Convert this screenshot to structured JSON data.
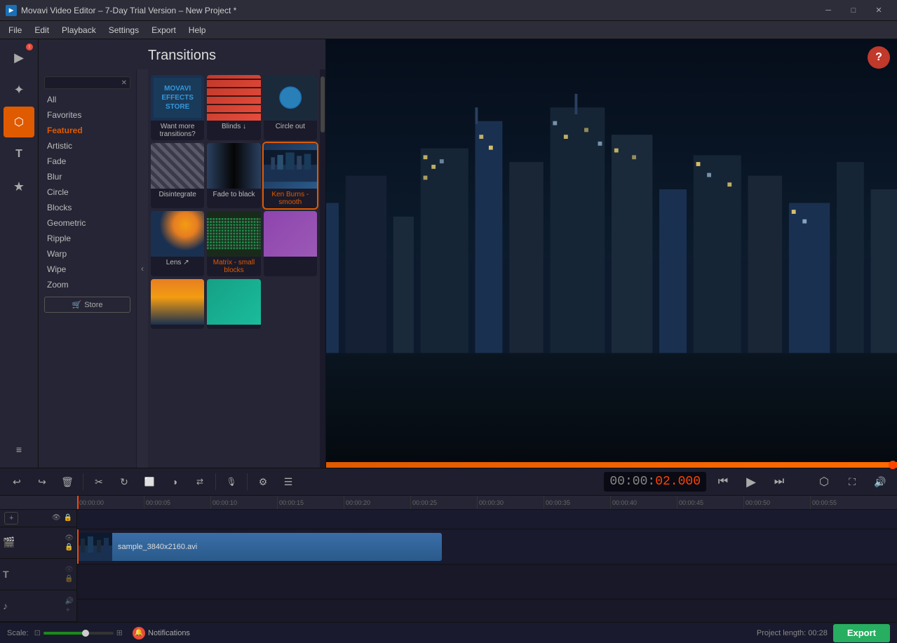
{
  "titleBar": {
    "appName": "Movavi Video Editor",
    "version": "7-Day Trial Version",
    "project": "New Project *",
    "minLabel": "─",
    "maxLabel": "□",
    "closeLabel": "✕"
  },
  "menuBar": {
    "items": [
      "File",
      "Edit",
      "Playback",
      "Settings",
      "Export",
      "Help"
    ]
  },
  "transitions": {
    "title": "Transitions",
    "searchPlaceholder": "",
    "categories": [
      {
        "id": "all",
        "label": "All",
        "active": false
      },
      {
        "id": "favorites",
        "label": "Favorites",
        "active": false
      },
      {
        "id": "featured",
        "label": "Featured",
        "active": true
      },
      {
        "id": "artistic",
        "label": "Artistic",
        "active": false
      },
      {
        "id": "fade",
        "label": "Fade",
        "active": false
      },
      {
        "id": "blur",
        "label": "Blur",
        "active": false
      },
      {
        "id": "circle",
        "label": "Circle",
        "active": false
      },
      {
        "id": "blocks",
        "label": "Blocks",
        "active": false
      },
      {
        "id": "geometric",
        "label": "Geometric",
        "active": false
      },
      {
        "id": "ripple",
        "label": "Ripple",
        "active": false
      },
      {
        "id": "warp",
        "label": "Warp",
        "active": false
      },
      {
        "id": "wipe",
        "label": "Wipe",
        "active": false
      },
      {
        "id": "zoom",
        "label": "Zoom",
        "active": false
      }
    ],
    "storeBtn": "Store",
    "items": [
      {
        "id": "effects-store",
        "label": "Want more transitions?",
        "type": "store",
        "highlighted": false
      },
      {
        "id": "blinds",
        "label": "Blinds ↓",
        "type": "blinds",
        "highlighted": false
      },
      {
        "id": "circle-out",
        "label": "Circle out",
        "type": "circle-out",
        "highlighted": false
      },
      {
        "id": "disintegrate",
        "label": "Disintegrate",
        "type": "disintegrate",
        "highlighted": false
      },
      {
        "id": "fade-black",
        "label": "Fade to black",
        "type": "fade-black",
        "highlighted": false
      },
      {
        "id": "ken-burns",
        "label": "Ken Burns - smooth",
        "type": "ken-burns",
        "highlighted": true
      },
      {
        "id": "lens",
        "label": "Lens ↗",
        "type": "lens",
        "highlighted": false
      },
      {
        "id": "matrix",
        "label": "Matrix - small blocks",
        "type": "matrix",
        "highlighted": true
      },
      {
        "id": "row2-1",
        "label": "",
        "type": "row2-1",
        "highlighted": false
      },
      {
        "id": "row2-2",
        "label": "",
        "type": "row2-2",
        "highlighted": false
      },
      {
        "id": "row2-3",
        "label": "",
        "type": "row2-3",
        "highlighted": false
      }
    ]
  },
  "preview": {
    "helpLabel": "?",
    "progressValue": 100
  },
  "editToolbar": {
    "undo": "↩",
    "redo": "↪",
    "delete": "🗑",
    "cut": "✂",
    "rotate": "↻",
    "crop": "⬜",
    "color": "◑",
    "flip": "⇄",
    "audio": "🎙",
    "settings": "⚙",
    "effects": "☰",
    "timeNormal": "00:00:",
    "timeHighlight": "02.000",
    "prevFrame": "⏮",
    "play": "▶",
    "nextFrame": "⏭",
    "export2": "⬡",
    "fullscreen": "⛶",
    "volume": "🔊"
  },
  "timeline": {
    "playheadPos": 0,
    "rulerMarks": [
      "00:00:00",
      "00:00:05",
      "00:00:10",
      "00:00:15",
      "00:00:20",
      "00:00:25",
      "00:00:30",
      "00:00:35",
      "00:00:40",
      "00:00:45",
      "00:00:50",
      "00:00:55"
    ],
    "tracks": [
      {
        "type": "video",
        "icon": "🎬",
        "hasEye": true,
        "hasLock": true
      },
      {
        "type": "text",
        "icon": "T",
        "hasEye": false,
        "hasLock": false
      },
      {
        "type": "music",
        "icon": "♪",
        "hasEye": false,
        "hasLock": false
      }
    ],
    "clips": [
      {
        "name": "sample_3840x2160.avi",
        "startPct": 0,
        "widthPct": 48,
        "track": 0
      }
    ]
  },
  "bottomBar": {
    "scaleLabel": "Scale:",
    "notificationsLabel": "Notifications",
    "projectLengthLabel": "Project length:",
    "projectLength": "00:28",
    "exportLabel": "Export"
  },
  "icons": {
    "search": "🔍",
    "store": "🏪",
    "eye": "👁",
    "lock": "🔒",
    "bell": "🔔"
  }
}
